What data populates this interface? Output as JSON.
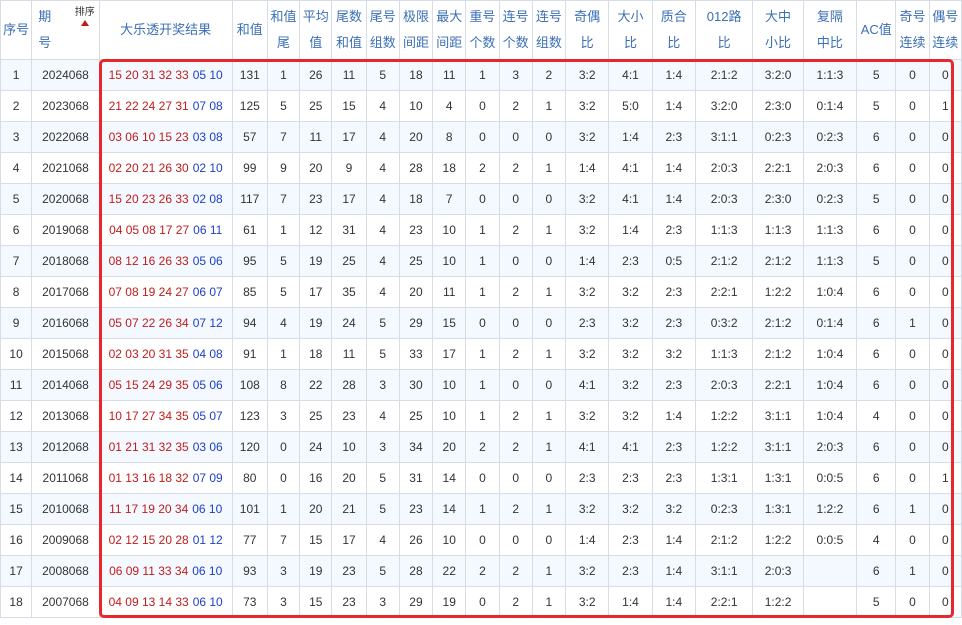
{
  "headers": {
    "seq": "序号",
    "period_top": "期",
    "period_bottom": "号",
    "sort_label": "排序",
    "result": "大乐透开奖结果",
    "sum": "和值",
    "sum_tail_top": "和值",
    "sum_tail_bottom": "尾",
    "avg_top": "平均",
    "avg_bottom": "值",
    "tail_sum_top": "尾数",
    "tail_sum_bottom": "和值",
    "tail_groups_top": "尾号",
    "tail_groups_bottom": "组数",
    "range_top": "极限",
    "range_bottom": "间距",
    "max_gap_top": "最大",
    "max_gap_bottom": "间距",
    "repeat_top": "重号",
    "repeat_bottom": "个数",
    "consec_count_top": "连号",
    "consec_count_bottom": "个数",
    "consec_groups_top": "连号",
    "consec_groups_bottom": "组数",
    "odd_even_top": "奇偶",
    "odd_even_bottom": "比",
    "big_small_top": "大小",
    "big_small_bottom": "比",
    "prime_top": "质合",
    "prime_bottom": "比",
    "route_top": "012路",
    "route_bottom": "比",
    "bms_top": "大中",
    "bms_bottom": "小比",
    "rep_top": "复隔",
    "rep_bottom": "中比",
    "ac": "AC值",
    "odd_consec_top": "奇号",
    "odd_consec_bottom": "连续",
    "even_consec_top": "偶号",
    "even_consec_bottom": "连续"
  },
  "colors": {
    "front": "#c21b1b",
    "back": "#1d3fc4",
    "header": "#3b6fb6",
    "highlight": "#e8262b"
  },
  "rows": [
    {
      "seq": "1",
      "period": "2024068",
      "front": "15 20 31 32 33",
      "back": "05 10",
      "sum": "131",
      "sum_tail": "1",
      "avg": "26",
      "tail_sum": "11",
      "tail_groups": "5",
      "range": "18",
      "max_gap": "11",
      "repeat": "1",
      "consec_count": "3",
      "consec_groups": "2",
      "odd_even": "3:2",
      "big_small": "4:1",
      "prime": "1:4",
      "route": "2:1:2",
      "bms": "3:2:0",
      "rep": "1:1:3",
      "ac": "5",
      "odd_consec": "0",
      "even_consec": "0"
    },
    {
      "seq": "2",
      "period": "2023068",
      "front": "21 22 24 27 31",
      "back": "07 08",
      "sum": "125",
      "sum_tail": "5",
      "avg": "25",
      "tail_sum": "15",
      "tail_groups": "4",
      "range": "10",
      "max_gap": "4",
      "repeat": "0",
      "consec_count": "2",
      "consec_groups": "1",
      "odd_even": "3:2",
      "big_small": "5:0",
      "prime": "1:4",
      "route": "3:2:0",
      "bms": "2:3:0",
      "rep": "0:1:4",
      "ac": "5",
      "odd_consec": "0",
      "even_consec": "1"
    },
    {
      "seq": "3",
      "period": "2022068",
      "front": "03 06 10 15 23",
      "back": "03 08",
      "sum": "57",
      "sum_tail": "7",
      "avg": "11",
      "tail_sum": "17",
      "tail_groups": "4",
      "range": "20",
      "max_gap": "8",
      "repeat": "0",
      "consec_count": "0",
      "consec_groups": "0",
      "odd_even": "3:2",
      "big_small": "1:4",
      "prime": "2:3",
      "route": "3:1:1",
      "bms": "0:2:3",
      "rep": "0:2:3",
      "ac": "6",
      "odd_consec": "0",
      "even_consec": "0"
    },
    {
      "seq": "4",
      "period": "2021068",
      "front": "02 20 21 26 30",
      "back": "02 10",
      "sum": "99",
      "sum_tail": "9",
      "avg": "20",
      "tail_sum": "9",
      "tail_groups": "4",
      "range": "28",
      "max_gap": "18",
      "repeat": "2",
      "consec_count": "2",
      "consec_groups": "1",
      "odd_even": "1:4",
      "big_small": "4:1",
      "prime": "1:4",
      "route": "2:0:3",
      "bms": "2:2:1",
      "rep": "2:0:3",
      "ac": "6",
      "odd_consec": "0",
      "even_consec": "0"
    },
    {
      "seq": "5",
      "period": "2020068",
      "front": "15 20 23 26 33",
      "back": "02 08",
      "sum": "117",
      "sum_tail": "7",
      "avg": "23",
      "tail_sum": "17",
      "tail_groups": "4",
      "range": "18",
      "max_gap": "7",
      "repeat": "0",
      "consec_count": "0",
      "consec_groups": "0",
      "odd_even": "3:2",
      "big_small": "4:1",
      "prime": "1:4",
      "route": "2:0:3",
      "bms": "2:3:0",
      "rep": "0:2:3",
      "ac": "5",
      "odd_consec": "0",
      "even_consec": "0"
    },
    {
      "seq": "6",
      "period": "2019068",
      "front": "04 05 08 17 27",
      "back": "06 11",
      "sum": "61",
      "sum_tail": "1",
      "avg": "12",
      "tail_sum": "31",
      "tail_groups": "4",
      "range": "23",
      "max_gap": "10",
      "repeat": "1",
      "consec_count": "2",
      "consec_groups": "1",
      "odd_even": "3:2",
      "big_small": "1:4",
      "prime": "2:3",
      "route": "1:1:3",
      "bms": "1:1:3",
      "rep": "1:1:3",
      "ac": "6",
      "odd_consec": "0",
      "even_consec": "0"
    },
    {
      "seq": "7",
      "period": "2018068",
      "front": "08 12 16 26 33",
      "back": "05 06",
      "sum": "95",
      "sum_tail": "5",
      "avg": "19",
      "tail_sum": "25",
      "tail_groups": "4",
      "range": "25",
      "max_gap": "10",
      "repeat": "1",
      "consec_count": "0",
      "consec_groups": "0",
      "odd_even": "1:4",
      "big_small": "2:3",
      "prime": "0:5",
      "route": "2:1:2",
      "bms": "2:1:2",
      "rep": "1:1:3",
      "ac": "5",
      "odd_consec": "0",
      "even_consec": "0"
    },
    {
      "seq": "8",
      "period": "2017068",
      "front": "07 08 19 24 27",
      "back": "06 07",
      "sum": "85",
      "sum_tail": "5",
      "avg": "17",
      "tail_sum": "35",
      "tail_groups": "4",
      "range": "20",
      "max_gap": "11",
      "repeat": "1",
      "consec_count": "2",
      "consec_groups": "1",
      "odd_even": "3:2",
      "big_small": "3:2",
      "prime": "2:3",
      "route": "2:2:1",
      "bms": "1:2:2",
      "rep": "1:0:4",
      "ac": "6",
      "odd_consec": "0",
      "even_consec": "0"
    },
    {
      "seq": "9",
      "period": "2016068",
      "front": "05 07 22 26 34",
      "back": "07 12",
      "sum": "94",
      "sum_tail": "4",
      "avg": "19",
      "tail_sum": "24",
      "tail_groups": "5",
      "range": "29",
      "max_gap": "15",
      "repeat": "0",
      "consec_count": "0",
      "consec_groups": "0",
      "odd_even": "2:3",
      "big_small": "3:2",
      "prime": "2:3",
      "route": "0:3:2",
      "bms": "2:1:2",
      "rep": "0:1:4",
      "ac": "6",
      "odd_consec": "1",
      "even_consec": "0"
    },
    {
      "seq": "10",
      "period": "2015068",
      "front": "02 03 20 31 35",
      "back": "04 08",
      "sum": "91",
      "sum_tail": "1",
      "avg": "18",
      "tail_sum": "11",
      "tail_groups": "5",
      "range": "33",
      "max_gap": "17",
      "repeat": "1",
      "consec_count": "2",
      "consec_groups": "1",
      "odd_even": "3:2",
      "big_small": "3:2",
      "prime": "3:2",
      "route": "1:1:3",
      "bms": "2:1:2",
      "rep": "1:0:4",
      "ac": "6",
      "odd_consec": "0",
      "even_consec": "0"
    },
    {
      "seq": "11",
      "period": "2014068",
      "front": "05 15 24 29 35",
      "back": "05 06",
      "sum": "108",
      "sum_tail": "8",
      "avg": "22",
      "tail_sum": "28",
      "tail_groups": "3",
      "range": "30",
      "max_gap": "10",
      "repeat": "1",
      "consec_count": "0",
      "consec_groups": "0",
      "odd_even": "4:1",
      "big_small": "3:2",
      "prime": "2:3",
      "route": "2:0:3",
      "bms": "2:2:1",
      "rep": "1:0:4",
      "ac": "6",
      "odd_consec": "0",
      "even_consec": "0"
    },
    {
      "seq": "12",
      "period": "2013068",
      "front": "10 17 27 34 35",
      "back": "05 07",
      "sum": "123",
      "sum_tail": "3",
      "avg": "25",
      "tail_sum": "23",
      "tail_groups": "4",
      "range": "25",
      "max_gap": "10",
      "repeat": "1",
      "consec_count": "2",
      "consec_groups": "1",
      "odd_even": "3:2",
      "big_small": "3:2",
      "prime": "1:4",
      "route": "1:2:2",
      "bms": "3:1:1",
      "rep": "1:0:4",
      "ac": "4",
      "odd_consec": "0",
      "even_consec": "0"
    },
    {
      "seq": "13",
      "period": "2012068",
      "front": "01 21 31 32 35",
      "back": "03 06",
      "sum": "120",
      "sum_tail": "0",
      "avg": "24",
      "tail_sum": "10",
      "tail_groups": "3",
      "range": "34",
      "max_gap": "20",
      "repeat": "2",
      "consec_count": "2",
      "consec_groups": "1",
      "odd_even": "4:1",
      "big_small": "4:1",
      "prime": "2:3",
      "route": "1:2:2",
      "bms": "3:1:1",
      "rep": "2:0:3",
      "ac": "6",
      "odd_consec": "0",
      "even_consec": "0"
    },
    {
      "seq": "14",
      "period": "2011068",
      "front": "01 13 16 18 32",
      "back": "07 09",
      "sum": "80",
      "sum_tail": "0",
      "avg": "16",
      "tail_sum": "20",
      "tail_groups": "5",
      "range": "31",
      "max_gap": "14",
      "repeat": "0",
      "consec_count": "0",
      "consec_groups": "0",
      "odd_even": "2:3",
      "big_small": "2:3",
      "prime": "2:3",
      "route": "1:3:1",
      "bms": "1:3:1",
      "rep": "0:0:5",
      "ac": "6",
      "odd_consec": "0",
      "even_consec": "1"
    },
    {
      "seq": "15",
      "period": "2010068",
      "front": "11 17 19 20 34",
      "back": "06 10",
      "sum": "101",
      "sum_tail": "1",
      "avg": "20",
      "tail_sum": "21",
      "tail_groups": "5",
      "range": "23",
      "max_gap": "14",
      "repeat": "1",
      "consec_count": "2",
      "consec_groups": "1",
      "odd_even": "3:2",
      "big_small": "3:2",
      "prime": "3:2",
      "route": "0:2:3",
      "bms": "1:3:1",
      "rep": "1:2:2",
      "ac": "6",
      "odd_consec": "1",
      "even_consec": "0"
    },
    {
      "seq": "16",
      "period": "2009068",
      "front": "02 12 15 20 28",
      "back": "01 12",
      "sum": "77",
      "sum_tail": "7",
      "avg": "15",
      "tail_sum": "17",
      "tail_groups": "4",
      "range": "26",
      "max_gap": "10",
      "repeat": "0",
      "consec_count": "0",
      "consec_groups": "0",
      "odd_even": "1:4",
      "big_small": "2:3",
      "prime": "1:4",
      "route": "2:1:2",
      "bms": "1:2:2",
      "rep": "0:0:5",
      "ac": "4",
      "odd_consec": "0",
      "even_consec": "0"
    },
    {
      "seq": "17",
      "period": "2008068",
      "front": "06 09 11 33 34",
      "back": "06 10",
      "sum": "93",
      "sum_tail": "3",
      "avg": "19",
      "tail_sum": "23",
      "tail_groups": "5",
      "range": "28",
      "max_gap": "22",
      "repeat": "2",
      "consec_count": "2",
      "consec_groups": "1",
      "odd_even": "3:2",
      "big_small": "2:3",
      "prime": "1:4",
      "route": "3:1:1",
      "bms": "2:0:3",
      "rep": "",
      "ac": "6",
      "odd_consec": "1",
      "even_consec": "0"
    },
    {
      "seq": "18",
      "period": "2007068",
      "front": "04 09 13 14 33",
      "back": "06 10",
      "sum": "73",
      "sum_tail": "3",
      "avg": "15",
      "tail_sum": "23",
      "tail_groups": "3",
      "range": "29",
      "max_gap": "19",
      "repeat": "0",
      "consec_count": "2",
      "consec_groups": "1",
      "odd_even": "3:2",
      "big_small": "1:4",
      "prime": "1:4",
      "route": "2:2:1",
      "bms": "1:2:2",
      "rep": "",
      "ac": "5",
      "odd_consec": "0",
      "even_consec": "0"
    }
  ]
}
